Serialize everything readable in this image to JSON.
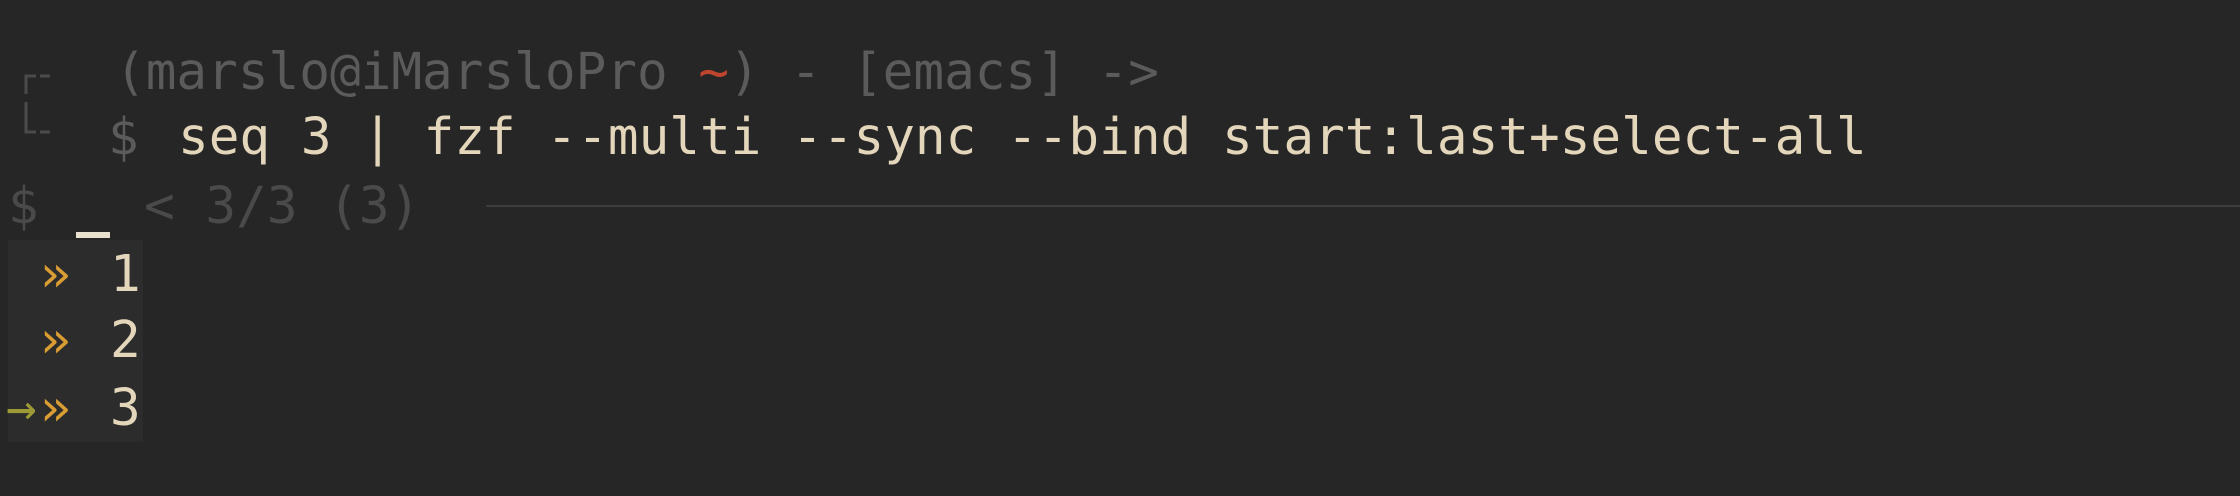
{
  "prompt": {
    "open_paren": "(",
    "user_host": "marslo@iMarsloPro",
    "home_symbol": "~",
    "suffix": ") - [emacs] ->",
    "dollar": "$",
    "command": "seq 3 | fzf --multi --sync --bind start:last+select-all"
  },
  "fzf": {
    "prompt_symbol": "$",
    "info": "< 3/3 (3)",
    "cursor": "_",
    "marker_symbol": "»",
    "pointer_symbol": "→",
    "items": [
      {
        "text": "1",
        "selected": true,
        "current": false
      },
      {
        "text": "2",
        "selected": true,
        "current": false
      },
      {
        "text": "3",
        "selected": true,
        "current": true
      }
    ]
  },
  "colors": {
    "background": "#262626",
    "text": "#e3d6bb",
    "dim": "#5b5b5b",
    "home": "#c0452f",
    "marker": "#d99d34",
    "pointer": "#9c9a35"
  }
}
